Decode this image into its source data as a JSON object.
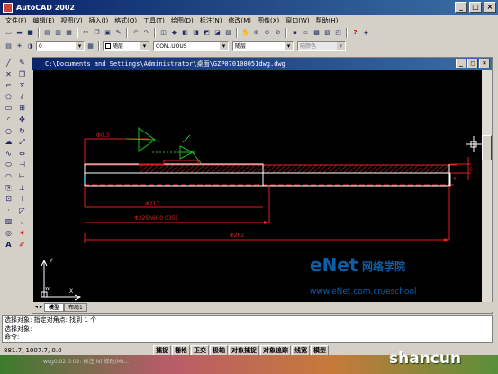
{
  "window": {
    "title": "AutoCAD 2002",
    "min": "_",
    "max": "□",
    "close": "×"
  },
  "menu": [
    "文件(F)",
    "编辑(E)",
    "视图(V)",
    "插入(I)",
    "格式(O)",
    "工具(T)",
    "绘图(D)",
    "标注(N)",
    "修改(M)",
    "图像(X)",
    "窗口(W)",
    "帮助(H)"
  ],
  "properties_bar": {
    "layer": "0",
    "color": "随层",
    "linetype": "CON..UOUS",
    "lineweight": "随层",
    "plotstyle": "随颜色"
  },
  "drawing_window": {
    "title": "C:\\Documents and Settings\\Administrator\\桌面\\GZP070100051dwg.dwg",
    "tabs": [
      "模型",
      "布局1"
    ]
  },
  "drawing": {
    "dims": [
      "Φ0.3",
      "Φ217",
      "Φ225h6(-0.035)",
      "Φ262",
      "6",
      "4"
    ],
    "ucs": {
      "y": "Y",
      "x": "X",
      "w": "W"
    }
  },
  "command": {
    "lines": [
      "选择对象:   指定对角点: 找到 1 个",
      "选择对象:",
      "命令:"
    ]
  },
  "status": {
    "coords": "881.7, 1007.7, 0.0",
    "buttons": [
      "捕捉",
      "栅格",
      "正交",
      "极轴",
      "对象捕捉",
      "对象追踪",
      "线宽",
      "模型"
    ]
  },
  "taskbar": {
    "text": "wsg0.02  0.02:  标注(N) 修改(M)..."
  },
  "watermarks": {
    "enet": "eNet",
    "enet_cn": "网络学院",
    "url": "www.eNet.com.cn/eschool",
    "shancun": "shancun"
  }
}
